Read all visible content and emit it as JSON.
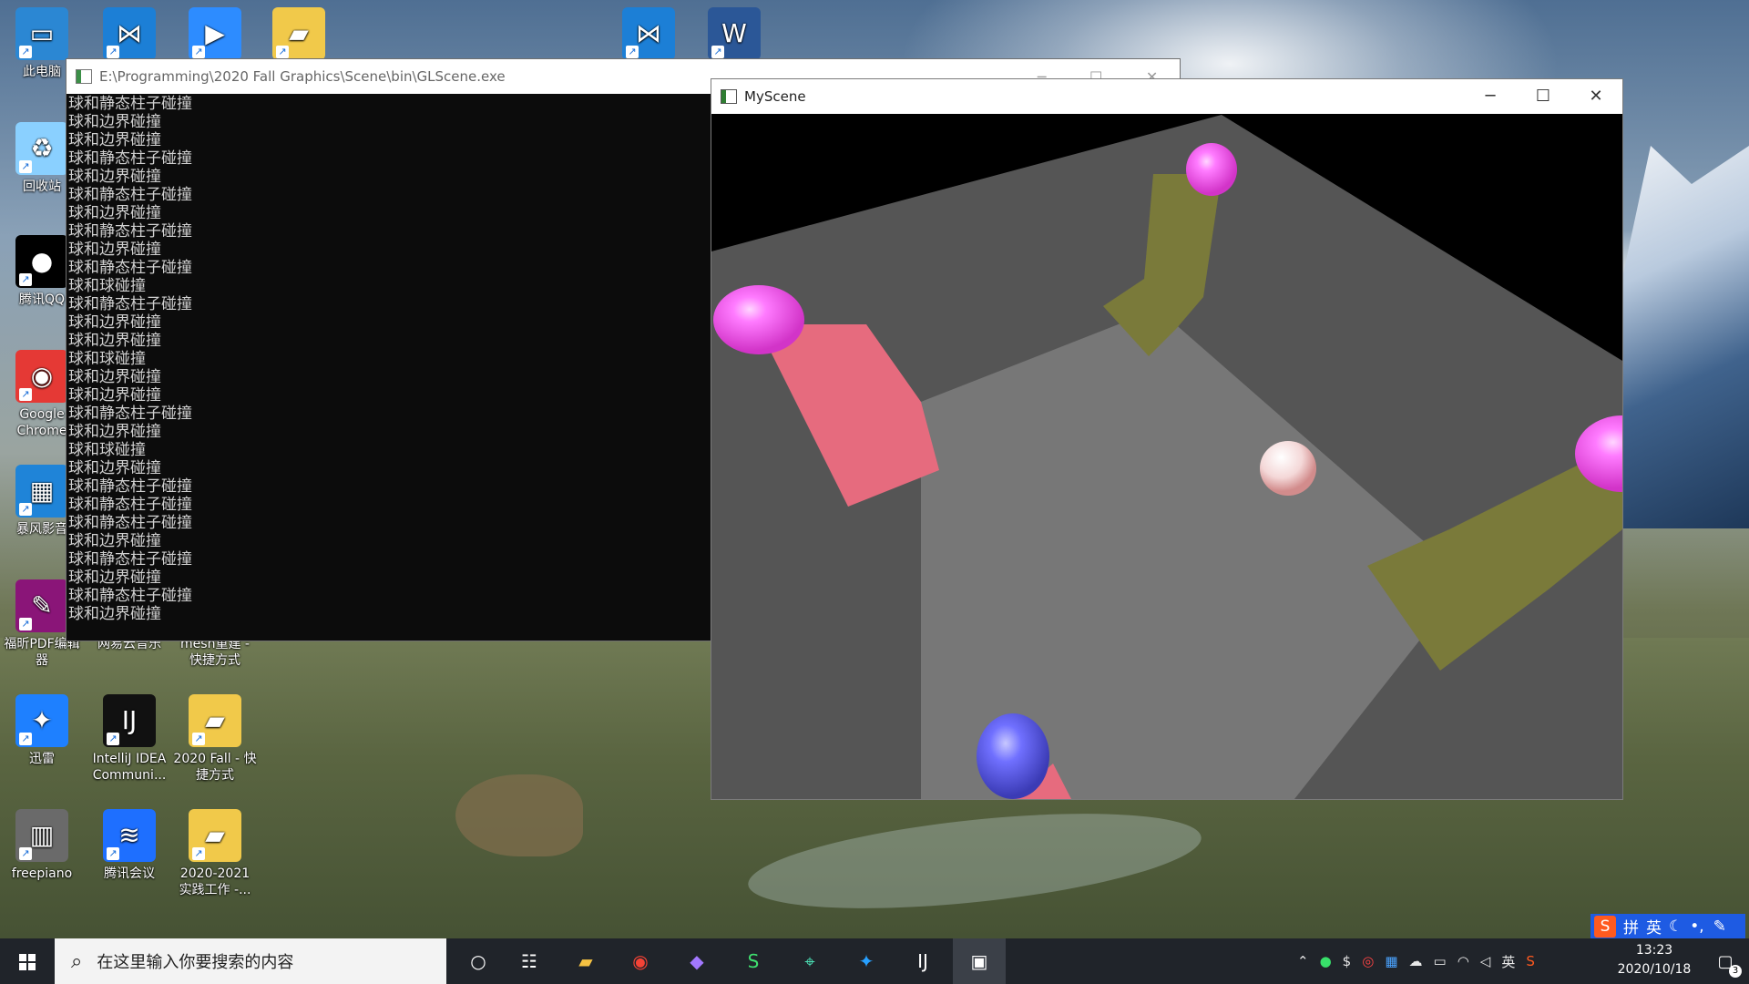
{
  "desktop": {
    "icons": [
      {
        "id": "this-pc",
        "label": "此电脑",
        "color": "#2b87d3"
      },
      {
        "id": "vscode-top",
        "label": "",
        "color": "#1c7fd6"
      },
      {
        "id": "zoom",
        "label": "",
        "color": "#2d8cff"
      },
      {
        "id": "folder-top",
        "label": "",
        "color": "#f1c94a"
      },
      {
        "id": "vscode-top-2",
        "label": "",
        "color": "#1c7fd6"
      },
      {
        "id": "word",
        "label": "",
        "color": "#2b5797"
      },
      {
        "id": "recycle-bin",
        "label": "回收站",
        "color": "#8ad0ff"
      },
      {
        "id": "qq",
        "label": "腾讯QQ",
        "color": "#000000"
      },
      {
        "id": "chrome",
        "label": "Google Chrome",
        "color": "#e53935"
      },
      {
        "id": "storm-player",
        "label": "暴风影音",
        "color": "#1f84d8"
      },
      {
        "id": "foxit",
        "label": "福昕PDF编辑器",
        "color": "#8a1578"
      },
      {
        "id": "netease",
        "label": "网易云音乐",
        "color": "#d32f2f"
      },
      {
        "id": "mesh-folder",
        "label": "mesh重建 - 快捷方式",
        "color": "#f1c94a"
      },
      {
        "id": "xunlei",
        "label": "迅雷",
        "color": "#1e80ff"
      },
      {
        "id": "intellij",
        "label": "IntelliJ IDEA Communi...",
        "color": "#111111"
      },
      {
        "id": "folder-2020",
        "label": "2020 Fall - 快捷方式",
        "color": "#f1c94a"
      },
      {
        "id": "freepiano",
        "label": "freepiano",
        "color": "#6a6a6a"
      },
      {
        "id": "tencent-meeting",
        "label": "腾讯会议",
        "color": "#1e6fff"
      },
      {
        "id": "folder-practice",
        "label": "2020-2021 实践工作 -...",
        "color": "#f1c94a"
      }
    ]
  },
  "console": {
    "title": "E:\\Programming\\2020 Fall Graphics\\Scene\\bin\\GLScene.exe",
    "lines": [
      "球和静态柱子碰撞",
      "球和边界碰撞",
      "球和边界碰撞",
      "球和静态柱子碰撞",
      "球和边界碰撞",
      "球和静态柱子碰撞",
      "球和边界碰撞",
      "球和静态柱子碰撞",
      "球和边界碰撞",
      "球和静态柱子碰撞",
      "球和球碰撞",
      "球和静态柱子碰撞",
      "球和边界碰撞",
      "球和边界碰撞",
      "球和球碰撞",
      "球和边界碰撞",
      "球和边界碰撞",
      "球和静态柱子碰撞",
      "球和边界碰撞",
      "球和球碰撞",
      "球和边界碰撞",
      "球和静态柱子碰撞",
      "球和静态柱子碰撞",
      "球和静态柱子碰撞",
      "球和边界碰撞",
      "球和静态柱子碰撞",
      "球和边界碰撞",
      "球和静态柱子碰撞",
      "球和边界碰撞"
    ]
  },
  "scene_window": {
    "title": "MyScene",
    "minimize_glyph": "─",
    "maximize_glyph": "☐",
    "close_glyph": "✕"
  },
  "taskbar": {
    "search_placeholder": "在这里输入你要搜索的内容",
    "time": "13:23",
    "date": "2020/10/18",
    "notification_count": "3",
    "input_lang_1": "英",
    "ime_mode": "拼",
    "ime_lang": "英"
  }
}
